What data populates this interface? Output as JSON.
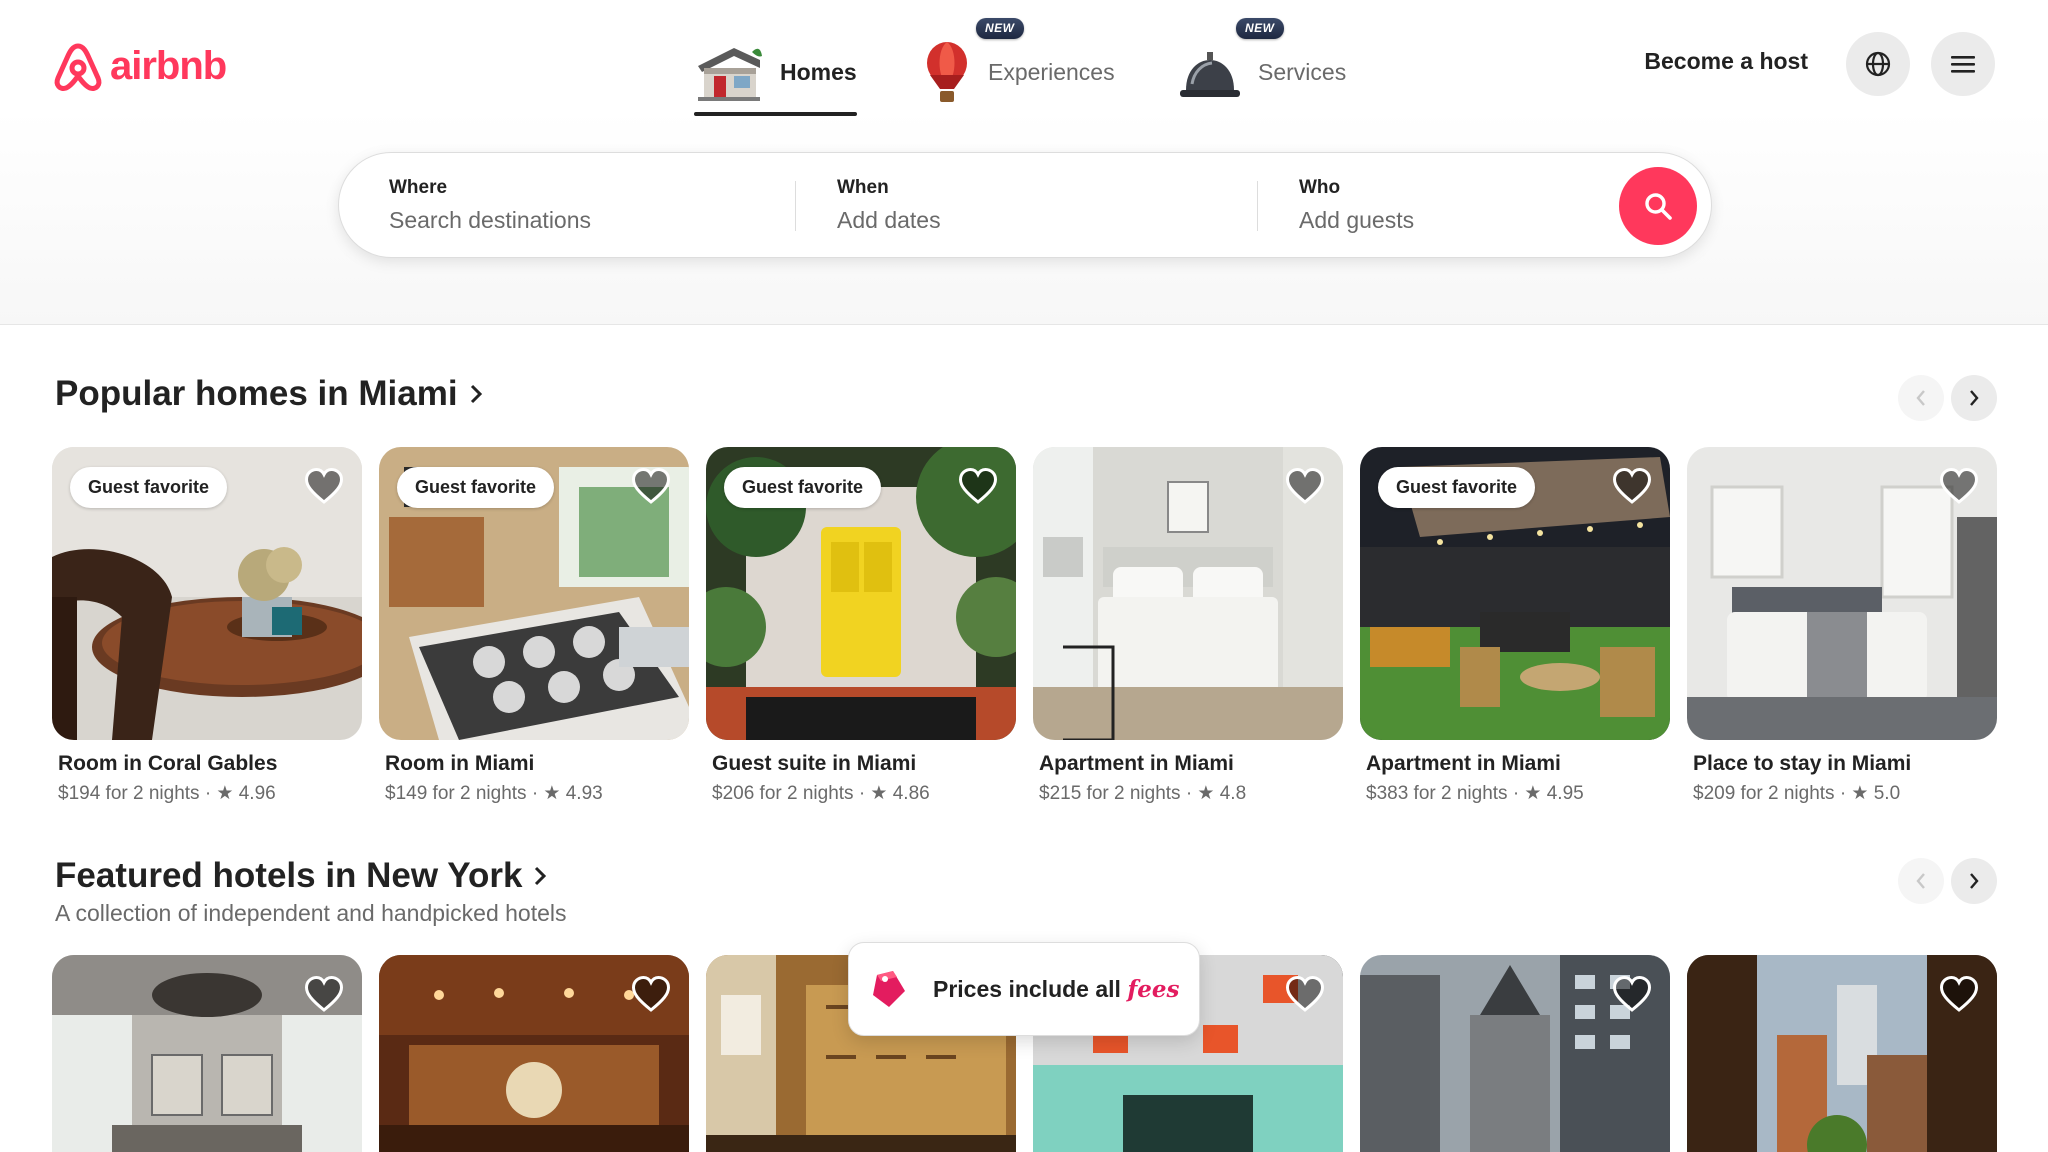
{
  "brand": {
    "name": "airbnb",
    "color": "#ff385c"
  },
  "nav": {
    "tabs": [
      {
        "label": "Homes",
        "icon": "house-icon",
        "active": true,
        "badge": ""
      },
      {
        "label": "Experiences",
        "icon": "hot-air-balloon-icon",
        "active": false,
        "badge": "NEW"
      },
      {
        "label": "Services",
        "icon": "service-bell-icon",
        "active": false,
        "badge": "NEW"
      }
    ],
    "become_host": "Become a host",
    "language_icon": "globe-icon",
    "menu_icon": "hamburger-menu-icon"
  },
  "search": {
    "where_label": "Where",
    "where_placeholder": "Search destinations",
    "when_label": "When",
    "when_placeholder": "Add dates",
    "who_label": "Who",
    "who_placeholder": "Add guests",
    "button_icon": "search-icon"
  },
  "popular": {
    "title": "Popular homes in Miami",
    "cards": [
      {
        "badge": "Guest favorite",
        "title": "Room in Coral Gables",
        "meta": "$194 for 2 nights · ★ 4.96"
      },
      {
        "badge": "Guest favorite",
        "title": "Room in Miami",
        "meta": "$149 for 2 nights · ★ 4.93"
      },
      {
        "badge": "Guest favorite",
        "title": "Guest suite in Miami",
        "meta": "$206 for 2 nights · ★ 4.86"
      },
      {
        "badge": "",
        "title": "Apartment in Miami",
        "meta": "$215 for 2 nights · ★ 4.8"
      },
      {
        "badge": "Guest favorite",
        "title": "Apartment in Miami",
        "meta": "$383 for 2 nights · ★ 4.95"
      },
      {
        "badge": "",
        "title": "Place to stay in Miami",
        "meta": "$209 for 2 nights · ★ 5.0"
      }
    ]
  },
  "featured": {
    "title": "Featured hotels in New York",
    "subtitle": "A collection of independent and handpicked hotels"
  },
  "toast": {
    "text_before": "Prices include all ",
    "text_fees": "fees",
    "icon": "price-tag-icon"
  }
}
